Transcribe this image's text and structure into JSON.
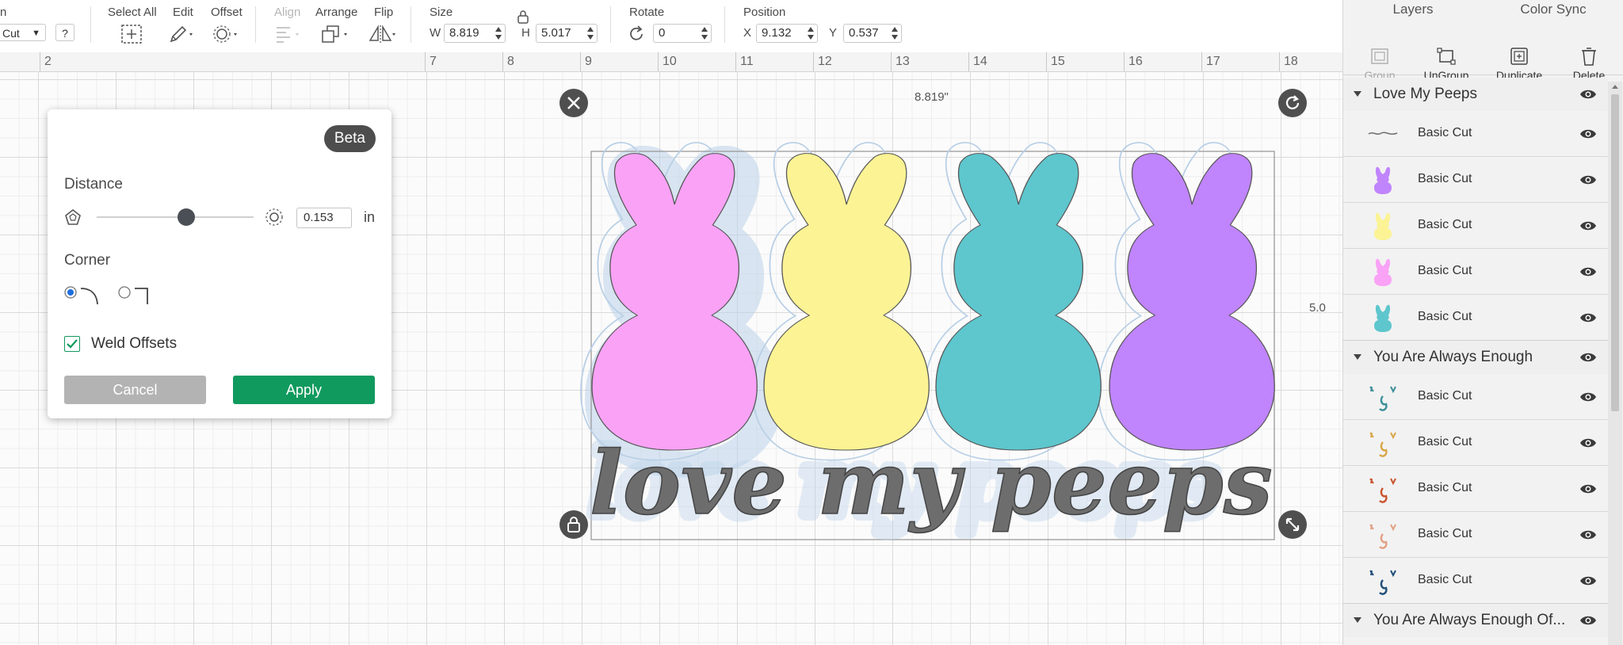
{
  "toolbar": {
    "edge_label": "n",
    "linetype_value": "Cut",
    "help": "?",
    "select_all": "Select All",
    "edit": "Edit",
    "offset": "Offset",
    "align": "Align",
    "arrange": "Arrange",
    "flip": "Flip",
    "size": "Size",
    "w_label": "W",
    "w_value": "8.819",
    "h_label": "H",
    "h_value": "5.017",
    "rotate": "Rotate",
    "rotate_value": "0",
    "position": "Position",
    "x_label": "X",
    "x_value": "9.132",
    "y_label": "Y",
    "y_value": "0.537"
  },
  "ruler": [
    "2",
    "7",
    "8",
    "9",
    "10",
    "11",
    "12",
    "13",
    "14",
    "15",
    "16",
    "17",
    "18"
  ],
  "canvas": {
    "width_readout": "8.819\"",
    "height_readout": "5.0",
    "artwork_text": "love my peeps"
  },
  "offset_popup": {
    "badge": "Beta",
    "distance_label": "Distance",
    "distance_value": "0.153",
    "distance_unit": "in",
    "distance_slider_fraction": 0.57,
    "corner_label": "Corner",
    "corner_selected": "rounded",
    "weld_label": "Weld Offsets",
    "weld_checked": true,
    "cancel": "Cancel",
    "apply": "Apply",
    "apply_color": "#119a5e"
  },
  "panel": {
    "tabs": [
      "Layers",
      "Color Sync"
    ],
    "tools": [
      "Group",
      "UnGroup",
      "Duplicate",
      "Delete"
    ],
    "groups": [
      {
        "name": "Love My Peeps",
        "layers": [
          {
            "name": "Basic Cut",
            "thumb": "text",
            "color": "#6d6d6d"
          },
          {
            "name": "Basic Cut",
            "thumb": "bunny",
            "color": "#c084fc"
          },
          {
            "name": "Basic Cut",
            "thumb": "bunny",
            "color": "#fbf394"
          },
          {
            "name": "Basic Cut",
            "thumb": "bunny",
            "color": "#f9a2f6"
          },
          {
            "name": "Basic Cut",
            "thumb": "bunny",
            "color": "#5ec6cd"
          }
        ]
      },
      {
        "name": "You Are Always Enough",
        "layers": [
          {
            "name": "Basic Cut",
            "thumb": "glyphs",
            "color": "#3d8f98"
          },
          {
            "name": "Basic Cut",
            "thumb": "glyphs",
            "color": "#d8a646"
          },
          {
            "name": "Basic Cut",
            "thumb": "glyphs",
            "color": "#c9542f"
          },
          {
            "name": "Basic Cut",
            "thumb": "glyphs",
            "color": "#e2a082"
          },
          {
            "name": "Basic Cut",
            "thumb": "glyphs",
            "color": "#1f4e79"
          }
        ]
      },
      {
        "name": "You Are Always Enough Of...",
        "layers": []
      }
    ]
  }
}
